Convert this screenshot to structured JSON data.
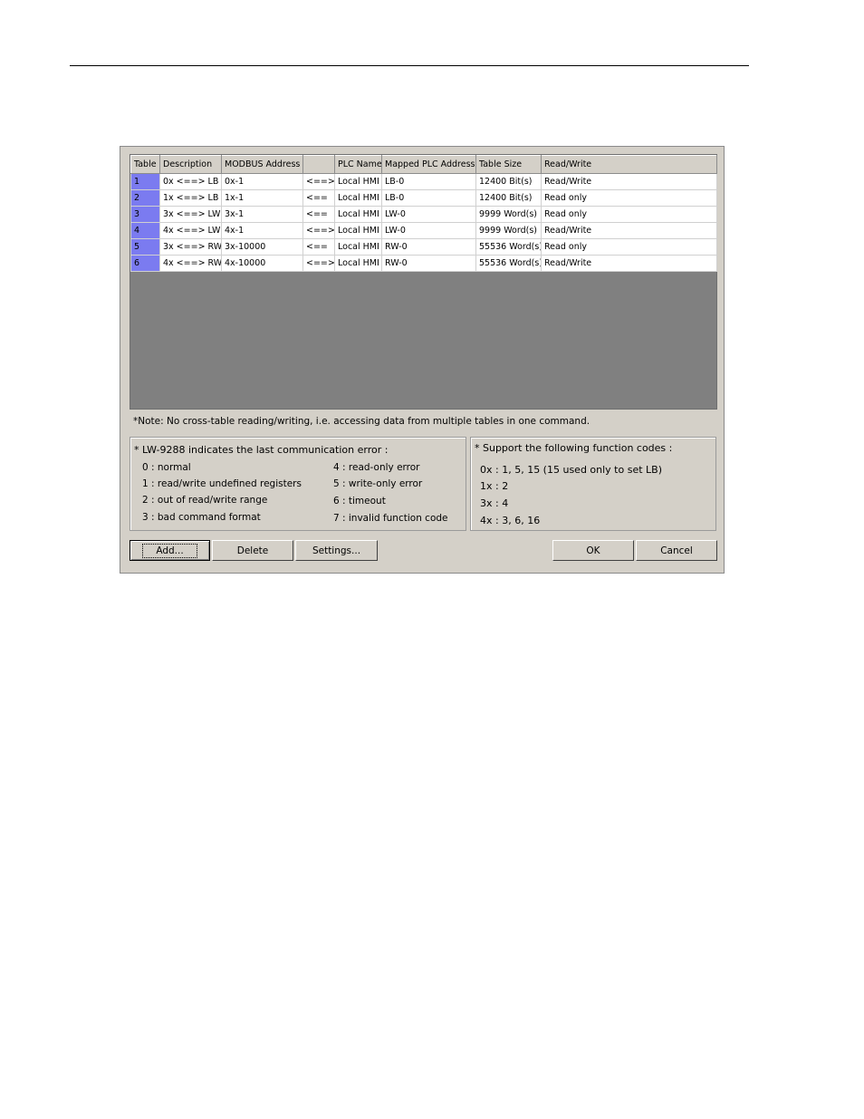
{
  "grid": {
    "headers": [
      "Table",
      "Description",
      "MODBUS Address",
      "",
      "PLC Name",
      "Mapped PLC Address",
      "Table Size",
      "Read/Write"
    ],
    "rows": [
      [
        "1",
        "0x <==> LB",
        "0x-1",
        "<==>",
        "Local HMI",
        "LB-0",
        "12400 Bit(s)",
        "Read/Write"
      ],
      [
        "2",
        "1x <==> LB",
        "1x-1",
        "<==",
        "Local HMI",
        "LB-0",
        "12400 Bit(s)",
        "Read only"
      ],
      [
        "3",
        "3x <==> LW",
        "3x-1",
        "<==",
        "Local HMI",
        "LW-0",
        "9999 Word(s)",
        "Read only"
      ],
      [
        "4",
        "4x <==> LW",
        "4x-1",
        "<==>",
        "Local HMI",
        "LW-0",
        "9999 Word(s)",
        "Read/Write"
      ],
      [
        "5",
        "3x <==> RW",
        "3x-10000",
        "<==",
        "Local HMI",
        "RW-0",
        "55536 Word(s)",
        "Read only"
      ],
      [
        "6",
        "4x <==> RW",
        "4x-10000",
        "<==>",
        "Local HMI",
        "RW-0",
        "55536 Word(s)",
        "Read/Write"
      ]
    ]
  },
  "note": "*Note: No cross-table reading/writing, i.e. accessing data from multiple tables in one command.",
  "error_group": {
    "title": "* LW-9288 indicates the last communication error :",
    "left": [
      "0 : normal",
      "1 : read/write undefined registers",
      "2 : out of read/write range",
      "3 : bad command format"
    ],
    "right": [
      "4 : read-only error",
      "5 : write-only error",
      "6 : timeout",
      "7 : invalid function code"
    ]
  },
  "function_group": {
    "title": "* Support the following function codes :",
    "items": [
      "0x : 1, 5, 15 (15 used only to set LB)",
      "1x : 2",
      "3x : 4",
      "4x : 3, 6, 16"
    ]
  },
  "buttons": {
    "add": "Add...",
    "delete": "Delete",
    "settings": "Settings...",
    "ok": "OK",
    "cancel": "Cancel"
  }
}
